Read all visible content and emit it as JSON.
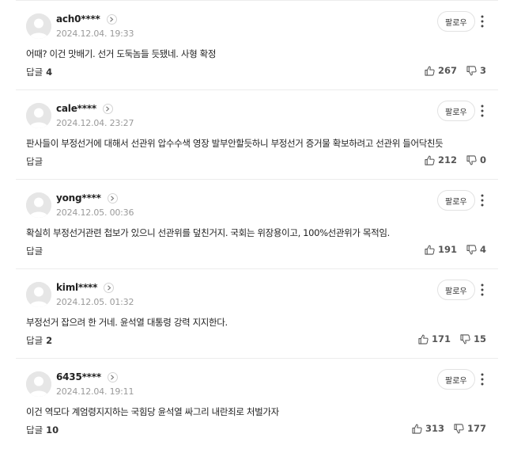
{
  "labels": {
    "follow": "팔로우",
    "reply": "답글"
  },
  "comments": [
    {
      "author": "ach0****",
      "timestamp": "2024.12.04. 19:33",
      "text": "어때? 이건 맛배기. 선거 도둑놈들 듯됐네. 사형 확정",
      "reply_count": "4",
      "likes": "267",
      "dislikes": "3"
    },
    {
      "author": "cale****",
      "timestamp": "2024.12.04. 23:27",
      "text": "판사들이 부정선거에 대해서 선관위 압수수색 영장 발부안할듯하니 부정선거 증거물 확보하려고 선관위 들어닥친듯",
      "reply_count": "",
      "likes": "212",
      "dislikes": "0"
    },
    {
      "author": "yong****",
      "timestamp": "2024.12.05. 00:36",
      "text": "확실히 부정선거관련 첩보가 있으니 선관위를 덮친거지. 국회는 위장용이고, 100%선관위가 목적임.",
      "reply_count": "",
      "likes": "191",
      "dislikes": "4"
    },
    {
      "author": "kiml****",
      "timestamp": "2024.12.05. 01:32",
      "text": "부정선거 잡으려 한 거네. 윤석열 대통령 강력 지지한다.",
      "reply_count": "2",
      "likes": "171",
      "dislikes": "15"
    },
    {
      "author": "6435****",
      "timestamp": "2024.12.04. 19:11",
      "text": "이건 역모다 계엄령지지하는 국힘당 윤석열 싸그리 내란죄로 처벌가자",
      "reply_count": "10",
      "likes": "313",
      "dislikes": "177"
    }
  ],
  "icons": {
    "avatar": "default-avatar-icon",
    "profile": "chevron-right-icon",
    "more": "more-vertical-icon",
    "like": "thumbs-up-icon",
    "dislike": "thumbs-down-icon"
  },
  "colors": {
    "divider": "#ececec",
    "timestamp": "#9a9a9a",
    "avatar_bg": "#e6e6e6",
    "avatar_fg": "#ffffff"
  }
}
